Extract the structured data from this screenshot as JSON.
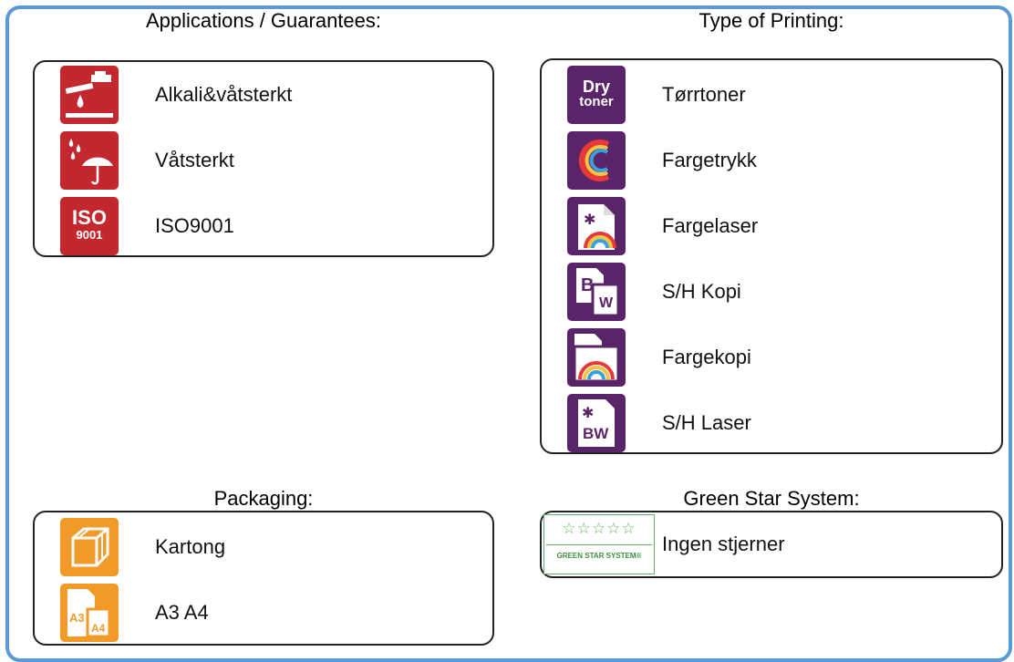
{
  "sections": {
    "applications": {
      "title": "Applications / Guarantees:",
      "items": [
        {
          "label": "Alkali&våtsterkt",
          "icon": "faucet-drip-icon"
        },
        {
          "label": "Våtsterkt",
          "icon": "rain-umbrella-icon"
        },
        {
          "label": "ISO9001",
          "icon": "iso-9001-icon",
          "icon_text_top": "ISO",
          "icon_text_bottom": "9001"
        }
      ]
    },
    "printing": {
      "title": "Type of Printing:",
      "items": [
        {
          "label": "Tørrtoner",
          "icon": "dry-toner-icon",
          "icon_text_top": "Dry",
          "icon_text_bottom": "toner"
        },
        {
          "label": "Fargetrykk",
          "icon": "color-print-c-icon",
          "icon_text_top": "C"
        },
        {
          "label": "Fargelaser",
          "icon": "color-laser-icon"
        },
        {
          "label": "S/H Kopi",
          "icon": "bw-copy-icon",
          "icon_text_top": "B",
          "icon_text_bottom": "W"
        },
        {
          "label": "Fargekopi",
          "icon": "color-copy-icon"
        },
        {
          "label": "S/H Laser",
          "icon": "bw-laser-icon",
          "icon_text_top": "BW"
        }
      ]
    },
    "packaging": {
      "title": "Packaging:",
      "items": [
        {
          "label": "Kartong",
          "icon": "carton-box-icon"
        },
        {
          "label": "A3 A4",
          "icon": "a3-a4-paper-icon",
          "icon_text_top": "A3",
          "icon_text_bottom": "A4"
        }
      ]
    },
    "greenstar": {
      "title": "Green Star System:",
      "items": [
        {
          "label": "Ingen stjerner",
          "icon": "green-star-system-icon",
          "icon_text_top": "☆☆☆☆☆",
          "icon_text_bottom": "GREEN STAR SYSTEM®"
        }
      ]
    }
  },
  "colors": {
    "frame": "#5b9bd5",
    "red": "#c4282f",
    "purple": "#5a2468",
    "orange": "#f29a28",
    "green": "#67b266"
  }
}
